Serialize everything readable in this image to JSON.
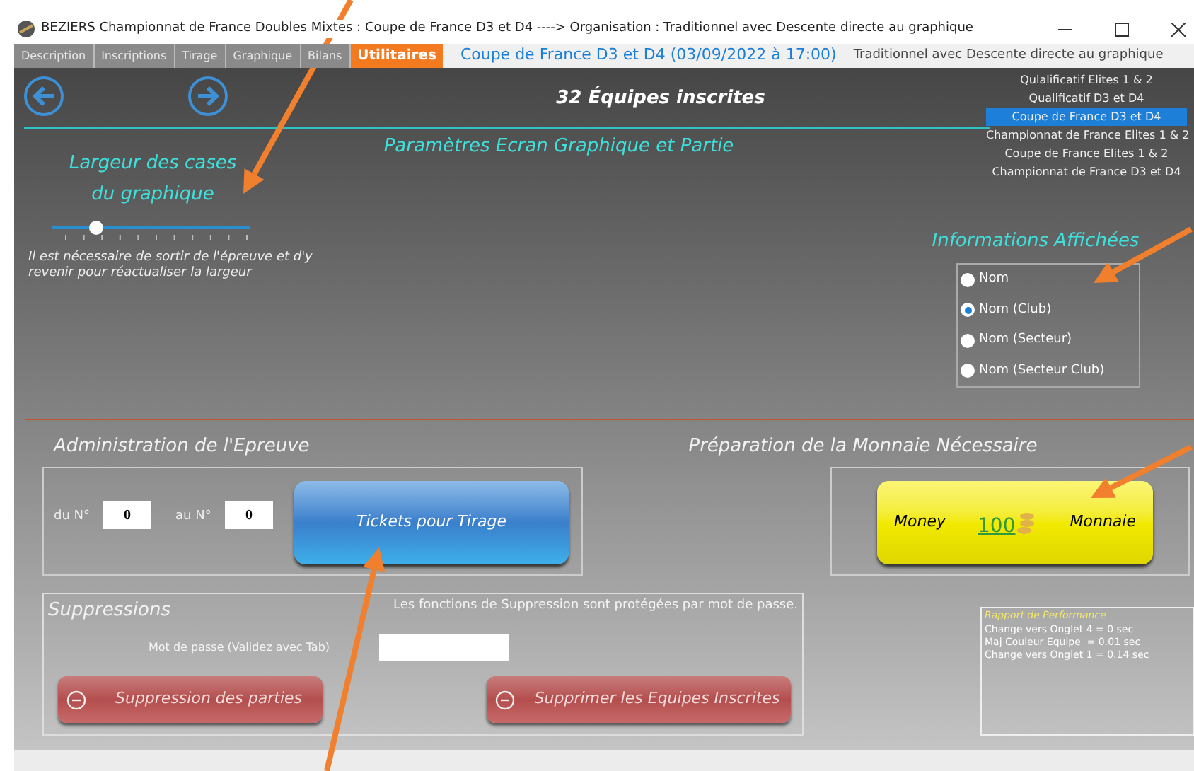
{
  "window": {
    "title": "BEZIERS Championnat de France Doubles Mixtes : Coupe de France D3 et D4 ----> Organisation : Traditionnel avec Descente directe au graphique"
  },
  "tabs": [
    {
      "label": "Description",
      "selected": false
    },
    {
      "label": "Inscriptions",
      "selected": false
    },
    {
      "label": "Tirage",
      "selected": false
    },
    {
      "label": "Graphique",
      "selected": false
    },
    {
      "label": "Bilans",
      "selected": false
    },
    {
      "label": "Utilitaires",
      "selected": true
    }
  ],
  "header": {
    "competition": "Coupe de France D3 et D4 (03/09/2022 à 17:00)",
    "organisation": "Traditionnel avec Descente directe au graphique"
  },
  "teams_count": "32 Équipes inscrites",
  "competitions": [
    {
      "label": "Qulalificatif Elites 1 & 2",
      "selected": false
    },
    {
      "label": "Qualificatif D3 et D4",
      "selected": false
    },
    {
      "label": "Coupe de France D3 et D4",
      "selected": true
    },
    {
      "label": "Championnat de France Elites 1 & 2",
      "selected": false
    },
    {
      "label": "Coupe de France Elites 1 & 2",
      "selected": false
    },
    {
      "label": "Championnat de France D3 et D4",
      "selected": false
    }
  ],
  "section_title": "Paramètres Ecran Graphique et Partie",
  "width_setting": {
    "title_lines": [
      "Largeur des cases",
      "du graphique"
    ],
    "level": 0.22,
    "note": "Il est nécessaire de sortir de l'épreuve et d'y revenir pour réactualiser la largeur"
  },
  "display_info": {
    "title": "Informations Affichées",
    "options": [
      {
        "label": "Nom",
        "selected": false
      },
      {
        "label": "Nom (Club)",
        "selected": true
      },
      {
        "label": "Nom (Secteur)",
        "selected": false
      },
      {
        "label": "Nom (Secteur Club)",
        "selected": false
      }
    ]
  },
  "administration": {
    "title": "Administration de l'Epreuve",
    "from_label": "du N°",
    "from_value": "0",
    "to_label": "au N°",
    "to_value": "0",
    "button": "Tickets pour Tirage"
  },
  "money": {
    "title": "Préparation de la Monnaie Nécessaire",
    "left_label": "Money",
    "amount": "100",
    "right_label": "Monnaie"
  },
  "deletions": {
    "title": "Suppressions",
    "notice": "Les fonctions de  Suppression sont protégées par mot de passe.",
    "password_label": "Mot de passe (Validez avec Tab)",
    "buttons": [
      "Suppression des parties",
      "Supprimer les Equipes Inscrites"
    ]
  },
  "performance": {
    "title": "Rapport de Performance",
    "lines": [
      "Change vers Onglet 4 = 0 sec",
      "Maj Couleur Equipe  = 0.01 sec",
      "Change vers Onglet 1 = 0.14 sec"
    ]
  }
}
